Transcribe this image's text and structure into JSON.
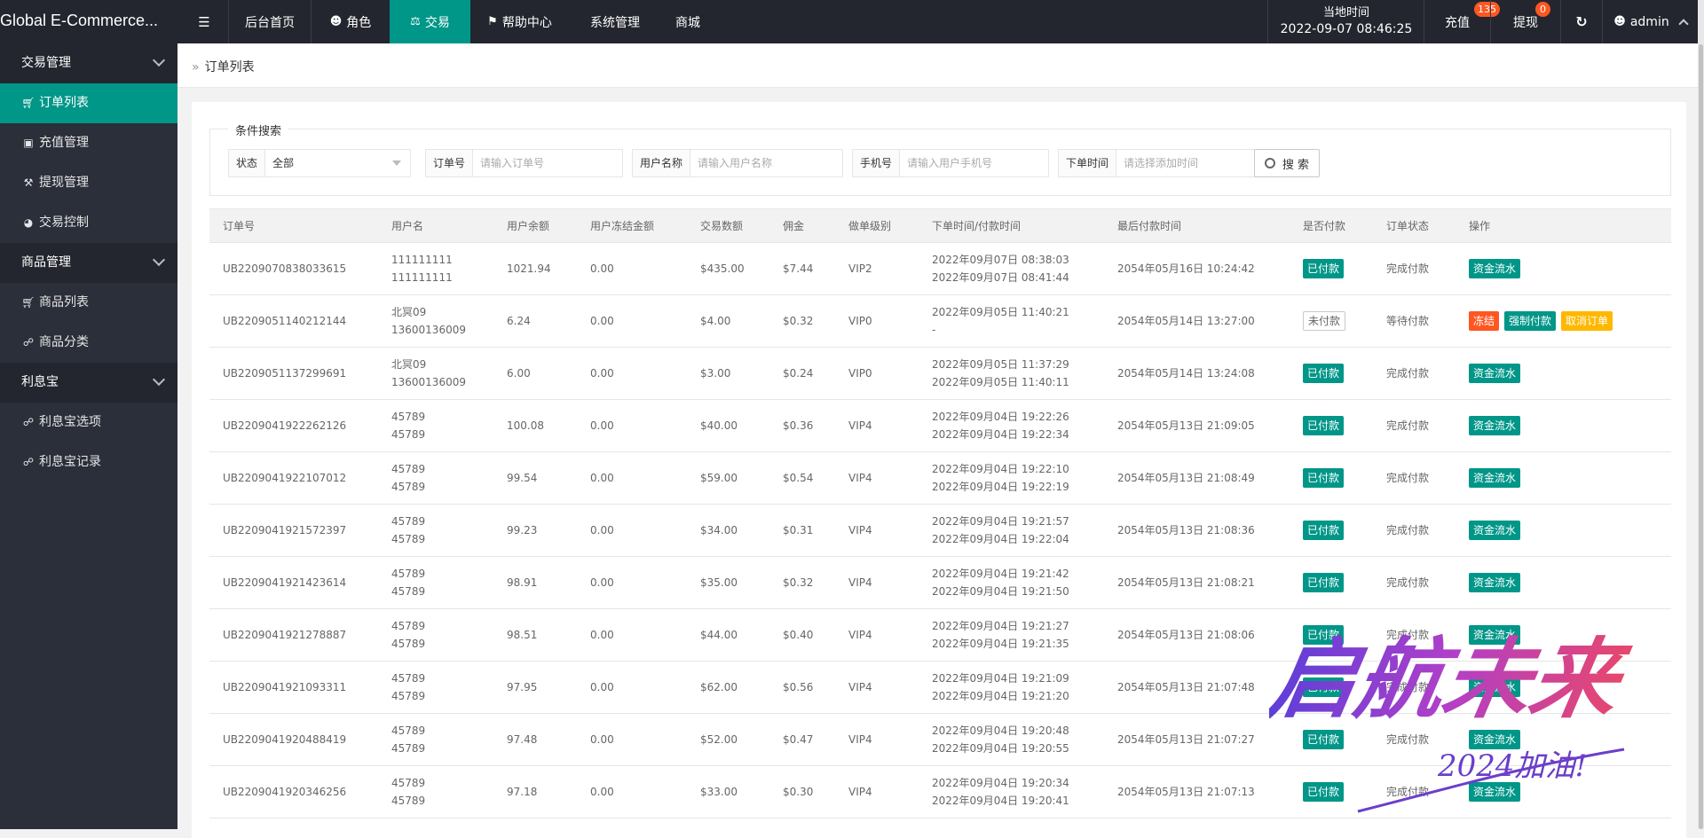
{
  "topbar": {
    "brand": "Global E-Commerce...",
    "nav": [
      {
        "label": "后台首页",
        "icon": ""
      },
      {
        "label": "角色",
        "icon": "person-icon"
      },
      {
        "label": "交易",
        "icon": "scale-icon"
      },
      {
        "label": "帮助中心",
        "icon": "flag-icon"
      },
      {
        "label": "系统管理",
        "icon": ""
      },
      {
        "label": "商城",
        "icon": ""
      }
    ],
    "clock_label": "当地时间",
    "clock_value": "2022-09-07 08:46:25",
    "recharge": "充值",
    "recharge_badge": "135",
    "withdraw": "提现",
    "withdraw_badge": "0",
    "user": "admin"
  },
  "sidebar": {
    "groups": [
      {
        "label": "交易管理",
        "items": [
          {
            "label": "订单列表",
            "icon": "cart-icon"
          },
          {
            "label": "充值管理",
            "icon": "card-icon"
          },
          {
            "label": "提现管理",
            "icon": "hammer-icon"
          },
          {
            "label": "交易控制",
            "icon": "gauge-icon"
          }
        ]
      },
      {
        "label": "商品管理",
        "items": [
          {
            "label": "商品列表",
            "icon": "cart-icon"
          },
          {
            "label": "商品分类",
            "icon": "link-icon"
          }
        ]
      },
      {
        "label": "利息宝",
        "items": [
          {
            "label": "利息宝选项",
            "icon": "link-icon"
          },
          {
            "label": "利息宝记录",
            "icon": "link-icon"
          }
        ]
      }
    ]
  },
  "breadcrumb": "订单列表",
  "search": {
    "legend": "条件搜索",
    "status_label": "状态",
    "status_value": "全部",
    "order_label": "订单号",
    "order_placeholder": "请输入订单号",
    "username_label": "用户名称",
    "username_placeholder": "请输入用户名称",
    "phone_label": "手机号",
    "phone_placeholder": "请输入用户手机号",
    "time_label": "下单时间",
    "time_placeholder": "请选择添加时间",
    "button": "搜 索"
  },
  "table": {
    "headers": [
      "订单号",
      "用户名",
      "用户余额",
      "用户冻结金额",
      "交易数额",
      "佣金",
      "做单级别",
      "下单时间/付款时间",
      "最后付款时间",
      "是否付款",
      "订单状态",
      "操作"
    ],
    "rows": [
      {
        "order": "UB2209070838033615",
        "user1": "111111111",
        "user2": "111111111",
        "balance": "1021.94",
        "frozen": "0.00",
        "amount": "$435.00",
        "commission": "$7.44",
        "level": "VIP2",
        "t1": "2022年09月07日 08:38:03",
        "t2": "2022年09月07日 08:41:44",
        "last": "2054年05月16日 10:24:42",
        "paid": "已付款",
        "paid_style": "green",
        "status": "完成付款",
        "actions": [
          {
            "label": "资金流水",
            "style": "green"
          }
        ]
      },
      {
        "order": "UB2209051140212144",
        "user1": "北冥09",
        "user2": "13600136009",
        "balance": "6.24",
        "frozen": "0.00",
        "amount": "$4.00",
        "commission": "$0.32",
        "level": "VIP0",
        "t1": "2022年09月05日 11:40:21",
        "t2": "-",
        "last": "2054年05月14日 13:27:00",
        "paid": "未付款",
        "paid_style": "plain",
        "status": "等待付款",
        "actions": [
          {
            "label": "冻结",
            "style": "orange"
          },
          {
            "label": "强制付款",
            "style": "green"
          },
          {
            "label": "取消订单",
            "style": "yellow"
          }
        ]
      },
      {
        "order": "UB2209051137299691",
        "user1": "北冥09",
        "user2": "13600136009",
        "balance": "6.00",
        "frozen": "0.00",
        "amount": "$3.00",
        "commission": "$0.24",
        "level": "VIP0",
        "t1": "2022年09月05日 11:37:29",
        "t2": "2022年09月05日 11:40:11",
        "last": "2054年05月14日 13:24:08",
        "paid": "已付款",
        "paid_style": "green",
        "status": "完成付款",
        "actions": [
          {
            "label": "资金流水",
            "style": "green"
          }
        ]
      },
      {
        "order": "UB2209041922262126",
        "user1": "45789",
        "user2": "45789",
        "balance": "100.08",
        "frozen": "0.00",
        "amount": "$40.00",
        "commission": "$0.36",
        "level": "VIP4",
        "t1": "2022年09月04日 19:22:26",
        "t2": "2022年09月04日 19:22:34",
        "last": "2054年05月13日 21:09:05",
        "paid": "已付款",
        "paid_style": "green",
        "status": "完成付款",
        "actions": [
          {
            "label": "资金流水",
            "style": "green"
          }
        ]
      },
      {
        "order": "UB2209041922107012",
        "user1": "45789",
        "user2": "45789",
        "balance": "99.54",
        "frozen": "0.00",
        "amount": "$59.00",
        "commission": "$0.54",
        "level": "VIP4",
        "t1": "2022年09月04日 19:22:10",
        "t2": "2022年09月04日 19:22:19",
        "last": "2054年05月13日 21:08:49",
        "paid": "已付款",
        "paid_style": "green",
        "status": "完成付款",
        "actions": [
          {
            "label": "资金流水",
            "style": "green"
          }
        ]
      },
      {
        "order": "UB2209041921572397",
        "user1": "45789",
        "user2": "45789",
        "balance": "99.23",
        "frozen": "0.00",
        "amount": "$34.00",
        "commission": "$0.31",
        "level": "VIP4",
        "t1": "2022年09月04日 19:21:57",
        "t2": "2022年09月04日 19:22:04",
        "last": "2054年05月13日 21:08:36",
        "paid": "已付款",
        "paid_style": "green",
        "status": "完成付款",
        "actions": [
          {
            "label": "资金流水",
            "style": "green"
          }
        ]
      },
      {
        "order": "UB2209041921423614",
        "user1": "45789",
        "user2": "45789",
        "balance": "98.91",
        "frozen": "0.00",
        "amount": "$35.00",
        "commission": "$0.32",
        "level": "VIP4",
        "t1": "2022年09月04日 19:21:42",
        "t2": "2022年09月04日 19:21:50",
        "last": "2054年05月13日 21:08:21",
        "paid": "已付款",
        "paid_style": "green",
        "status": "完成付款",
        "actions": [
          {
            "label": "资金流水",
            "style": "green"
          }
        ]
      },
      {
        "order": "UB2209041921278887",
        "user1": "45789",
        "user2": "45789",
        "balance": "98.51",
        "frozen": "0.00",
        "amount": "$44.00",
        "commission": "$0.40",
        "level": "VIP4",
        "t1": "2022年09月04日 19:21:27",
        "t2": "2022年09月04日 19:21:35",
        "last": "2054年05月13日 21:08:06",
        "paid": "已付款",
        "paid_style": "green",
        "status": "完成付款",
        "actions": [
          {
            "label": "资金流水",
            "style": "green"
          }
        ]
      },
      {
        "order": "UB2209041921093311",
        "user1": "45789",
        "user2": "45789",
        "balance": "97.95",
        "frozen": "0.00",
        "amount": "$62.00",
        "commission": "$0.56",
        "level": "VIP4",
        "t1": "2022年09月04日 19:21:09",
        "t2": "2022年09月04日 19:21:20",
        "last": "2054年05月13日 21:07:48",
        "paid": "已付款",
        "paid_style": "green",
        "status": "完成付款",
        "actions": [
          {
            "label": "资金流水",
            "style": "green"
          }
        ]
      },
      {
        "order": "UB2209041920488419",
        "user1": "45789",
        "user2": "45789",
        "balance": "97.48",
        "frozen": "0.00",
        "amount": "$52.00",
        "commission": "$0.47",
        "level": "VIP4",
        "t1": "2022年09月04日 19:20:48",
        "t2": "2022年09月04日 19:20:55",
        "last": "2054年05月13日 21:07:27",
        "paid": "已付款",
        "paid_style": "green",
        "status": "完成付款",
        "actions": [
          {
            "label": "资金流水",
            "style": "green"
          }
        ]
      },
      {
        "order": "UB2209041920346256",
        "user1": "45789",
        "user2": "45789",
        "balance": "97.18",
        "frozen": "0.00",
        "amount": "$33.00",
        "commission": "$0.30",
        "level": "VIP4",
        "t1": "2022年09月04日 19:20:34",
        "t2": "2022年09月04日 19:20:41",
        "last": "2054年05月13日 21:07:13",
        "paid": "已付款",
        "paid_style": "green",
        "status": "完成付款",
        "actions": [
          {
            "label": "资金流水",
            "style": "green"
          }
        ]
      }
    ]
  },
  "watermark": {
    "main": "启航未来",
    "sub": "2024加油!"
  },
  "colors": {
    "accent": "#009688",
    "topbar": "#23262e",
    "sidebar": "#2b2f3a",
    "danger": "#ff5722",
    "warn": "#ffb800"
  }
}
